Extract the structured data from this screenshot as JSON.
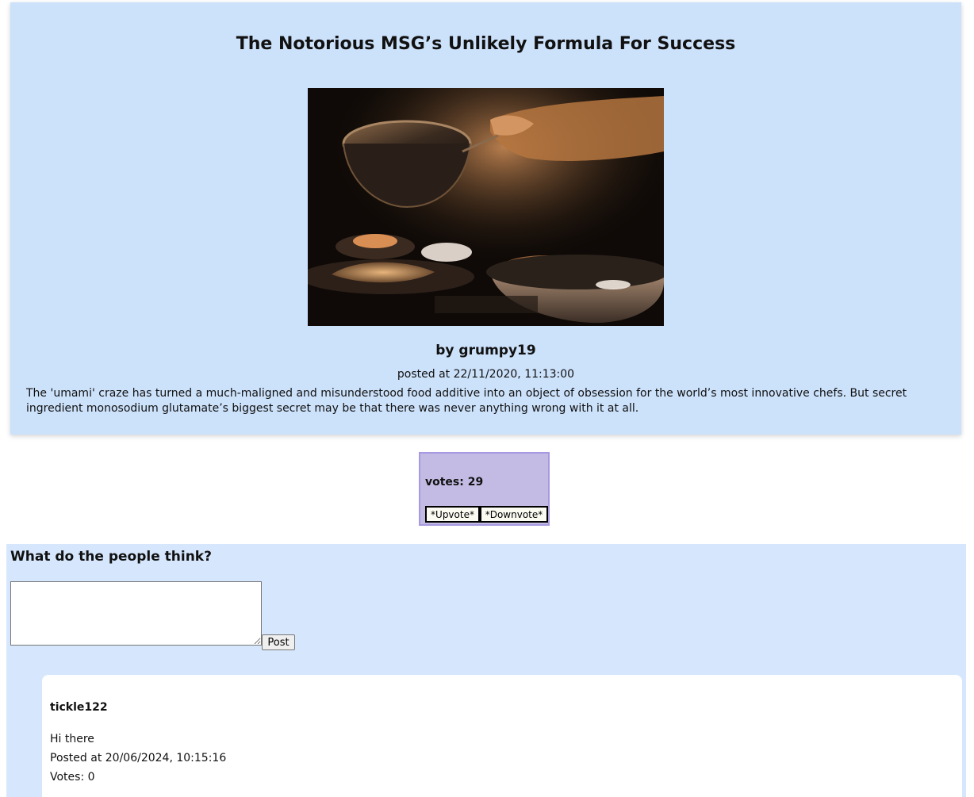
{
  "article": {
    "title": "The Notorious MSG’s Unlikely Formula For Success",
    "image_alt": "Chef plating dishes in a dark kitchen",
    "author": "by grumpy19",
    "posted": "posted at 22/11/2020, 11:13:00",
    "summary": "The 'umami' craze has turned a much-maligned and misunderstood food additive into an object of obsession for the world’s most innovative chefs. But secret ingredient monosodium glutamate’s biggest secret may be that there was never anything wrong with it at all."
  },
  "votes": {
    "label": "votes: 29",
    "upvote": "*Upvote*",
    "downvote": "*Downvote*"
  },
  "comments": {
    "heading": "What do the people think?",
    "input_value": "",
    "post_label": "Post",
    "items": [
      {
        "user": "tickle122",
        "text": "Hi there",
        "posted": "Posted at 20/06/2024, 10:15:16",
        "votes": "Votes: 0"
      }
    ]
  },
  "colors": {
    "article_bg": "#cce1fa",
    "vote_bg": "#c3bbe3",
    "comments_bg": "#d6e7fd"
  }
}
